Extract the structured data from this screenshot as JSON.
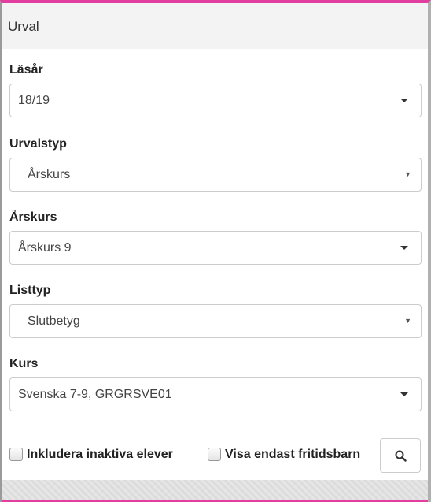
{
  "panel": {
    "title": "Urval"
  },
  "fields": {
    "lasar": {
      "label": "Läsår",
      "value": "18/19"
    },
    "urvalstyp": {
      "label": "Urvalstyp",
      "value": "Årskurs"
    },
    "arskurs": {
      "label": "Årskurs",
      "value": "Årskurs 9"
    },
    "listtyp": {
      "label": "Listtyp",
      "value": "Slutbetyg"
    },
    "kurs": {
      "label": "Kurs",
      "value": "Svenska 7-9, GRGRSVE01"
    }
  },
  "options": {
    "inkludera_inaktiva": {
      "label": "Inkludera inaktiva elever",
      "checked": false
    },
    "visa_fritidsbarn": {
      "label": "Visa endast fritidsbarn",
      "checked": false
    }
  },
  "icons": {
    "search": "search-icon",
    "caret": "caret-down-icon"
  },
  "colors": {
    "accent": "#e23ea0",
    "header_bg": "#f3f3f3",
    "border": "#cccccc"
  }
}
